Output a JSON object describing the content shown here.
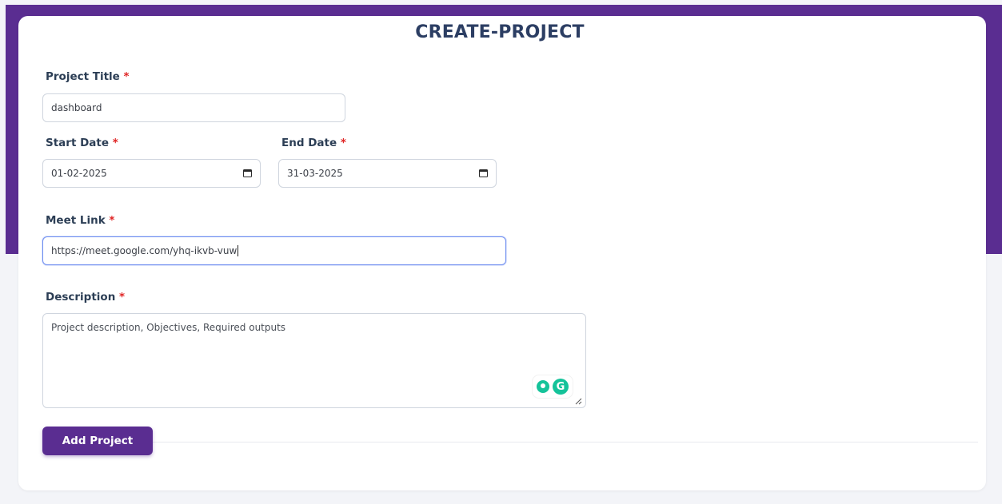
{
  "page": {
    "title": "CREATE-PROJECT",
    "required_mark": "*"
  },
  "form": {
    "project_title": {
      "label": "Project Title",
      "value": "dashboard"
    },
    "start_date": {
      "label": "Start Date",
      "value": "01-02-2025"
    },
    "end_date": {
      "label": "End Date",
      "value": "31-03-2025"
    },
    "meet_link": {
      "label": "Meet Link",
      "value": "https://meet.google.com/yhq-ikvb-vuw"
    },
    "description": {
      "label": "Description",
      "placeholder": "Project description, Objectives, Required outputs"
    },
    "submit_label": "Add Project"
  },
  "icons": {
    "date_picker": "calendar-icon",
    "grammarly": "grammarly-icon",
    "suggestion": "lightbulb-icon",
    "resize": "resize-handle-icon"
  },
  "colors": {
    "brand_purple": "#5a2d91",
    "title_text": "#2c3e63",
    "required": "#e02424",
    "focus_border": "#6f8ef0",
    "grammarly_green": "#15c39a"
  }
}
